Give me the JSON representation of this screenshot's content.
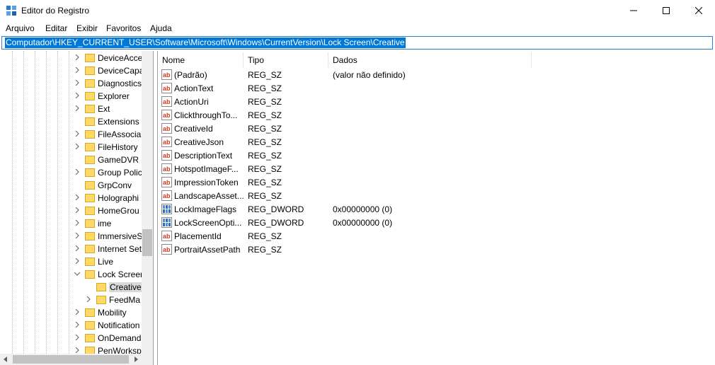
{
  "window": {
    "title": "Editor do Registro",
    "icon": "registry-editor-icon"
  },
  "menu": [
    "Arquivo",
    "Editar",
    "Exibir",
    "Favoritos",
    "Ajuda"
  ],
  "address": "Computador\\HKEY_CURRENT_USER\\Software\\Microsoft\\Windows\\CurrentVersion\\Lock Screen\\Creative",
  "tree": [
    {
      "label": "DeviceAcce",
      "depth": 0,
      "expander": "collapsed"
    },
    {
      "label": "DeviceCapa",
      "depth": 0,
      "expander": "collapsed"
    },
    {
      "label": "Diagnostics",
      "depth": 0,
      "expander": "collapsed"
    },
    {
      "label": "Explorer",
      "depth": 0,
      "expander": "collapsed"
    },
    {
      "label": "Ext",
      "depth": 0,
      "expander": "collapsed"
    },
    {
      "label": "Extensions",
      "depth": 0,
      "expander": "none"
    },
    {
      "label": "FileAssocia",
      "depth": 0,
      "expander": "collapsed"
    },
    {
      "label": "FileHistory",
      "depth": 0,
      "expander": "collapsed"
    },
    {
      "label": "GameDVR",
      "depth": 0,
      "expander": "none"
    },
    {
      "label": "Group Polic",
      "depth": 0,
      "expander": "collapsed"
    },
    {
      "label": "GrpConv",
      "depth": 0,
      "expander": "none"
    },
    {
      "label": "Holographi",
      "depth": 0,
      "expander": "collapsed"
    },
    {
      "label": "HomeGrou",
      "depth": 0,
      "expander": "collapsed"
    },
    {
      "label": "ime",
      "depth": 0,
      "expander": "collapsed"
    },
    {
      "label": "ImmersiveS",
      "depth": 0,
      "expander": "collapsed"
    },
    {
      "label": "Internet Set",
      "depth": 0,
      "expander": "collapsed"
    },
    {
      "label": "Live",
      "depth": 0,
      "expander": "collapsed"
    },
    {
      "label": "Lock Screen",
      "depth": 0,
      "expander": "expanded"
    },
    {
      "label": "Creative",
      "depth": 1,
      "expander": "none",
      "selected": true
    },
    {
      "label": "FeedMa",
      "depth": 1,
      "expander": "collapsed"
    },
    {
      "label": "Mobility",
      "depth": 0,
      "expander": "collapsed"
    },
    {
      "label": "Notification",
      "depth": 0,
      "expander": "collapsed"
    },
    {
      "label": "OnDemand",
      "depth": 0,
      "expander": "collapsed"
    },
    {
      "label": "PenWorksp",
      "depth": 0,
      "expander": "collapsed"
    }
  ],
  "columns": [
    "Nome",
    "Tipo",
    "Dados"
  ],
  "values": [
    {
      "name": "(Padrão)",
      "type": "REG_SZ",
      "data": "(valor não definido)",
      "icon": "string-value-icon"
    },
    {
      "name": "ActionText",
      "type": "REG_SZ",
      "data": "",
      "icon": "string-value-icon"
    },
    {
      "name": "ActionUri",
      "type": "REG_SZ",
      "data": "",
      "icon": "string-value-icon"
    },
    {
      "name": "ClickthroughTo...",
      "type": "REG_SZ",
      "data": "",
      "icon": "string-value-icon"
    },
    {
      "name": "CreativeId",
      "type": "REG_SZ",
      "data": "",
      "icon": "string-value-icon"
    },
    {
      "name": "CreativeJson",
      "type": "REG_SZ",
      "data": "",
      "icon": "string-value-icon"
    },
    {
      "name": "DescriptionText",
      "type": "REG_SZ",
      "data": "",
      "icon": "string-value-icon"
    },
    {
      "name": "HotspotImageF...",
      "type": "REG_SZ",
      "data": "",
      "icon": "string-value-icon"
    },
    {
      "name": "ImpressionToken",
      "type": "REG_SZ",
      "data": "",
      "icon": "string-value-icon"
    },
    {
      "name": "LandscapeAsset...",
      "type": "REG_SZ",
      "data": "",
      "icon": "string-value-icon"
    },
    {
      "name": "LockImageFlags",
      "type": "REG_DWORD",
      "data": "0x00000000 (0)",
      "icon": "dword-value-icon"
    },
    {
      "name": "LockScreenOpti...",
      "type": "REG_DWORD",
      "data": "0x00000000 (0)",
      "icon": "dword-value-icon"
    },
    {
      "name": "PlacementId",
      "type": "REG_SZ",
      "data": "",
      "icon": "string-value-icon"
    },
    {
      "name": "PortraitAssetPath",
      "type": "REG_SZ",
      "data": "",
      "icon": "string-value-icon"
    }
  ],
  "colors": {
    "selection": "#0078d7",
    "tree_selected": "#d9d9d9",
    "folder": "#ffd966"
  }
}
